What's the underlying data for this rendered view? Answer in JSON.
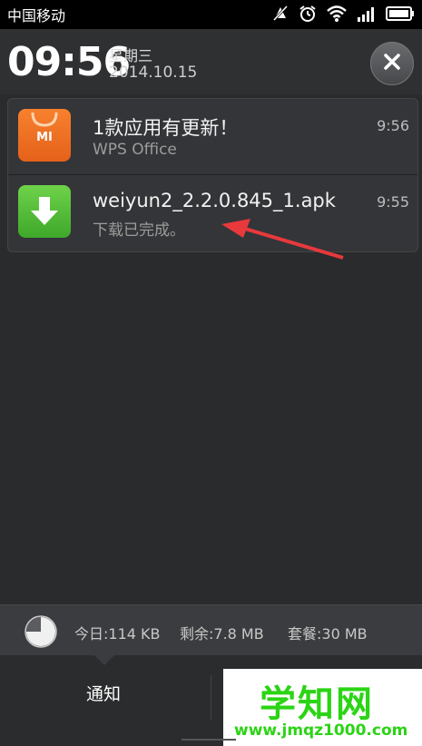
{
  "status_bar": {
    "carrier": "中国移动",
    "icons": [
      "muted-notification-icon",
      "alarm-icon",
      "wifi-icon",
      "signal-icon",
      "battery-icon"
    ]
  },
  "header": {
    "time": "09:56",
    "weekday": "星期三",
    "date": "2014.10.15",
    "clear_icon": "close-icon"
  },
  "notifications": [
    {
      "app_icon": "mi-store-icon",
      "icon_label": "MI",
      "title": "1款应用有更新！",
      "subtitle": "WPS Office",
      "time": "9:56"
    },
    {
      "app_icon": "download-icon",
      "title": "weiyun2_2.2.0.845_1.apk",
      "subtitle": "下载已完成。",
      "time": "9:55"
    }
  ],
  "data_usage": {
    "today": "今日:114 KB",
    "remaining": "剩余:7.8 MB",
    "plan": "套餐:30 MB",
    "used_fraction": 0.75
  },
  "tabs": {
    "notify": "通知"
  },
  "watermark": {
    "title": "学知网",
    "url": "www.jmqz1000.com"
  },
  "colors": {
    "accent_arrow": "#e8393c",
    "watermark_green": "#2bd414",
    "mi_orange": "#f26f22",
    "download_green": "#4fbe32"
  }
}
